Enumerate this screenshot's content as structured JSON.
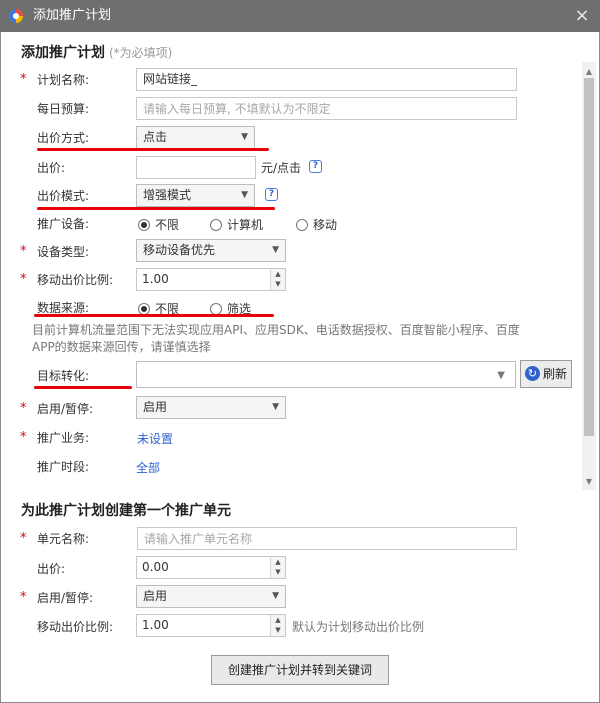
{
  "window": {
    "title": "添加推广计划",
    "close_label": "×"
  },
  "plan_section": {
    "title": "添加推广计划",
    "hint": "(*为必填项)"
  },
  "fields": {
    "plan_name": {
      "label": "计划名称:",
      "value": "网站链接_"
    },
    "daily_budget": {
      "label": "每日预算:",
      "placeholder": "请输入每日预算, 不填默认为不限定"
    },
    "bid_method": {
      "label": "出价方式:",
      "value": "点击"
    },
    "bid": {
      "label": "出价:",
      "value": "",
      "unit": "元/点击"
    },
    "bid_mode": {
      "label": "出价模式:",
      "value": "增强模式"
    },
    "device": {
      "label": "推广设备:",
      "options": [
        "不限",
        "计算机",
        "移动"
      ],
      "selected": "不限"
    },
    "device_type": {
      "label": "设备类型:",
      "value": "移动设备优先"
    },
    "mobile_ratio": {
      "label": "移动出价比例:",
      "value": "1.00"
    },
    "data_source": {
      "label": "数据来源:",
      "options": [
        "不限",
        "筛选"
      ],
      "selected": "不限"
    },
    "data_source_note": "目前计算机流量范围下无法实现应用API、应用SDK、电话数据授权、百度智能小程序、百度APP的数据来源回传，请谨慎选择",
    "target_conversion": {
      "label": "目标转化:",
      "value": "",
      "refresh_label": "刷新"
    },
    "status": {
      "label": "启用/暂停:",
      "value": "启用"
    },
    "business": {
      "label": "推广业务:",
      "value": "未设置"
    },
    "schedule": {
      "label": "推广时段:",
      "value": "全部"
    }
  },
  "unit_section": {
    "title": "为此推广计划创建第一个推广单元"
  },
  "unit_fields": {
    "unit_name": {
      "label": "单元名称:",
      "placeholder": "请输入推广单元名称"
    },
    "bid": {
      "label": "出价:",
      "value": "0.00"
    },
    "status": {
      "label": "启用/暂停:",
      "value": "启用"
    },
    "mobile_ratio": {
      "label": "移动出价比例:",
      "value": "1.00",
      "hint": "默认为计划移动出价比例"
    }
  },
  "submit_label": "创建推广计划并转到关键词",
  "colors": {
    "titlebar": "#6f6f6f",
    "accent_link": "#2f62cf",
    "required": "#d9001b",
    "annotation_underline": "#e8000b"
  }
}
